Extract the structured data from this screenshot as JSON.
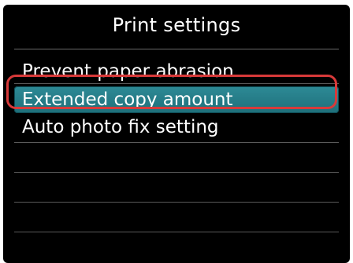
{
  "screen": {
    "title": "Print settings"
  },
  "menu": {
    "items": [
      {
        "label": "Prevent paper abrasion"
      },
      {
        "label": "Extended copy amount",
        "selected": true
      },
      {
        "label": "Auto photo fix setting"
      }
    ]
  },
  "colors": {
    "background": "#000000",
    "text": "#ffffff",
    "selection_fill": "#2d8a96",
    "highlight_ring": "#d83a3a",
    "divider": "#6a6a6a"
  }
}
